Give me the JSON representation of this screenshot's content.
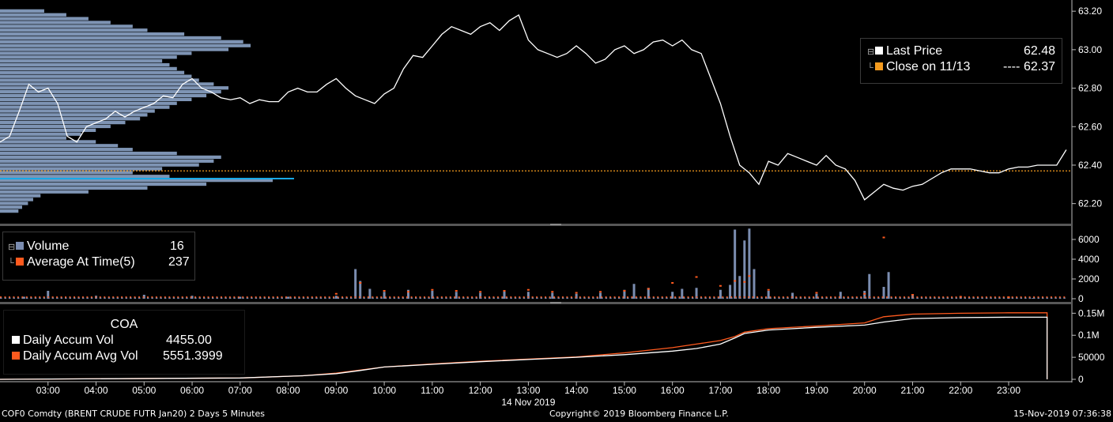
{
  "colors": {
    "price": "#ffffff",
    "profile": "#7e94b4",
    "profile_hi": "#19a8e6",
    "close_line": "#f39a1e",
    "avg": "#ff5a1e",
    "volume": "#7b8db0",
    "accum": "#ffffff",
    "accum_avg": "#ff5a1e",
    "panel_divider": "#575757"
  },
  "footer": {
    "left": "COF0 Comdty (BRENT CRUDE FUTR  Jan20) 2 Days 5 Minutes",
    "center": "Copyright© 2019 Bloomberg Finance L.P.",
    "right": "15-Nov-2019 07:36:38"
  },
  "price_legend": {
    "last_label": "Last Price",
    "last_value": "62.48",
    "close_label": "Close on 11/13",
    "close_dashes": "----",
    "close_value": "62.37"
  },
  "volume_legend": {
    "volume_label": "Volume",
    "volume_value": "16",
    "avg_label": "Average At Time(5)",
    "avg_value": "237"
  },
  "coa_legend": {
    "title": "COA",
    "accum_label": "Daily Accum Vol",
    "accum_value": "4455.00",
    "avg_label": "Daily Accum Avg Vol",
    "avg_value": "5551.3999"
  },
  "chart_data": [
    {
      "type": "line",
      "panel": "price",
      "ylim": [
        62.1,
        63.25
      ],
      "yticks": [
        "62.20",
        "62.40",
        "62.60",
        "62.80",
        "63.00",
        "63.20"
      ],
      "close_reference": 62.37,
      "series": [
        {
          "name": "Last Price",
          "x": [
            2.0,
            2.2,
            2.4,
            2.6,
            2.8,
            3.0,
            3.2,
            3.4,
            3.6,
            3.8,
            4.0,
            4.2,
            4.4,
            4.6,
            4.8,
            5.0,
            5.2,
            5.4,
            5.6,
            5.8,
            6.0,
            6.2,
            6.4,
            6.6,
            6.8,
            7.0,
            7.2,
            7.4,
            7.6,
            7.8,
            8.0,
            8.2,
            8.4,
            8.6,
            8.8,
            9.0,
            9.2,
            9.4,
            9.6,
            9.8,
            10.0,
            10.2,
            10.4,
            10.6,
            10.8,
            11.0,
            11.2,
            11.4,
            11.6,
            11.8,
            12.0,
            12.2,
            12.4,
            12.6,
            12.8,
            13.0,
            13.2,
            13.4,
            13.6,
            13.8,
            14.0,
            14.2,
            14.4,
            14.6,
            14.8,
            15.0,
            15.2,
            15.4,
            15.6,
            15.8,
            16.0,
            16.2,
            16.4,
            16.6,
            16.8,
            17.0,
            17.2,
            17.4,
            17.6,
            17.8,
            18.0,
            18.2,
            18.4,
            18.6,
            18.8,
            19.0,
            19.2,
            19.4,
            19.6,
            19.8,
            20.0,
            20.2,
            20.4,
            20.6,
            20.8,
            21.0,
            21.2,
            21.4,
            21.6,
            21.8,
            22.0,
            22.2,
            22.4,
            22.6,
            22.8,
            23.0,
            23.2,
            23.4,
            23.6,
            23.8,
            24.0,
            24.2
          ],
          "values": [
            62.52,
            62.55,
            62.68,
            62.82,
            62.78,
            62.8,
            62.72,
            62.55,
            62.52,
            62.6,
            62.62,
            62.64,
            62.68,
            62.65,
            62.68,
            62.7,
            62.72,
            62.76,
            62.75,
            62.82,
            62.85,
            62.8,
            62.78,
            62.75,
            62.74,
            62.75,
            62.72,
            62.74,
            62.73,
            62.73,
            62.78,
            62.8,
            62.78,
            62.78,
            62.82,
            62.85,
            62.8,
            62.76,
            62.74,
            62.72,
            62.77,
            62.8,
            62.9,
            62.97,
            62.96,
            63.02,
            63.08,
            63.12,
            63.1,
            63.08,
            63.12,
            63.14,
            63.1,
            63.15,
            63.18,
            63.05,
            63.0,
            62.98,
            62.96,
            62.98,
            63.02,
            62.98,
            62.93,
            62.95,
            63.0,
            63.02,
            62.98,
            63.0,
            63.04,
            63.05,
            63.02,
            63.05,
            63.0,
            62.98,
            62.85,
            62.72,
            62.55,
            62.4,
            62.36,
            62.3,
            62.42,
            62.4,
            62.46,
            62.44,
            62.42,
            62.4,
            62.45,
            62.4,
            62.38,
            62.32,
            62.22,
            62.26,
            62.3,
            62.28,
            62.27,
            62.29,
            62.3,
            62.33,
            62.36,
            62.38,
            62.38,
            62.38,
            62.37,
            62.36,
            62.36,
            62.38,
            62.39,
            62.39,
            62.4,
            62.4,
            62.4,
            62.48
          ]
        }
      ]
    },
    {
      "type": "bar",
      "panel": "volume",
      "ylim": [
        0,
        7200
      ],
      "yticks": [
        "0",
        "2000",
        "4000",
        "6000"
      ],
      "series": [
        {
          "name": "Volume",
          "x": [
            2.5,
            3.0,
            4.0,
            5.0,
            6.0,
            7.0,
            8.0,
            9.0,
            9.4,
            9.5,
            9.7,
            10.0,
            10.5,
            11.0,
            11.5,
            12.0,
            12.5,
            13.0,
            13.5,
            14.0,
            14.5,
            15.0,
            15.2,
            15.5,
            16.0,
            16.2,
            16.5,
            17.0,
            17.2,
            17.3,
            17.4,
            17.5,
            17.6,
            17.7,
            18.0,
            18.5,
            19.0,
            19.5,
            20.0,
            20.1,
            20.4,
            20.5,
            21.0,
            22.0,
            23.0,
            23.5
          ],
          "values": [
            200,
            800,
            300,
            400,
            300,
            200,
            200,
            300,
            3000,
            1800,
            1000,
            700,
            900,
            800,
            700,
            600,
            800,
            700,
            600,
            500,
            600,
            900,
            1500,
            1100,
            700,
            1000,
            1100,
            900,
            1400,
            7000,
            2300,
            5900,
            7100,
            3000,
            800,
            600,
            500,
            700,
            800,
            2500,
            1200,
            2700,
            400,
            200,
            100,
            60
          ]
        },
        {
          "name": "Average At Time(5)",
          "x": [
            9.0,
            9.5,
            10.0,
            10.5,
            11.0,
            11.5,
            12.0,
            12.5,
            13.0,
            13.5,
            14.0,
            14.5,
            15.0,
            15.5,
            16.0,
            16.5,
            17.0,
            17.3,
            17.5,
            17.6,
            18.0,
            19.0,
            20.0,
            20.4,
            21.0,
            22.0,
            23.0
          ],
          "values": [
            500,
            1600,
            800,
            700,
            900,
            800,
            700,
            800,
            900,
            700,
            600,
            700,
            800,
            1000,
            1600,
            2200,
            1300,
            1800,
            1700,
            2300,
            900,
            600,
            500,
            6200,
            400,
            200,
            150
          ]
        }
      ]
    },
    {
      "type": "line",
      "panel": "coa",
      "ylim": [
        0,
        165000
      ],
      "yticks": [
        "0",
        "50000",
        "0.1M",
        "0.15M"
      ],
      "series": [
        {
          "name": "Daily Accum Vol",
          "x": [
            2.0,
            7.0,
            8.3,
            9.0,
            9.5,
            10.0,
            11.0,
            12.0,
            13.0,
            14.0,
            15.0,
            16.0,
            16.5,
            17.0,
            17.3,
            17.5,
            18.0,
            19.0,
            20.0,
            20.4,
            21.0,
            22.0,
            23.0,
            23.8,
            23.8
          ],
          "values": [
            0,
            3000,
            8000,
            13000,
            20000,
            28000,
            34000,
            40000,
            45000,
            50000,
            56000,
            64000,
            70000,
            80000,
            94000,
            104000,
            112000,
            118000,
            123000,
            130000,
            138000,
            140000,
            141000,
            141000,
            0
          ]
        },
        {
          "name": "Daily Accum Avg Vol",
          "x": [
            2.0,
            7.0,
            8.3,
            9.0,
            9.5,
            10.0,
            11.0,
            12.0,
            13.0,
            14.0,
            15.0,
            16.0,
            16.5,
            17.0,
            17.3,
            17.5,
            18.0,
            19.0,
            20.0,
            20.4,
            21.0,
            22.0,
            23.0,
            23.8,
            23.8
          ],
          "values": [
            0,
            3000,
            8000,
            14000,
            21000,
            28000,
            35000,
            41000,
            46000,
            51000,
            60000,
            72000,
            80000,
            88000,
            97000,
            107000,
            115000,
            121000,
            128000,
            142000,
            148000,
            150000,
            151000,
            151000,
            0
          ]
        }
      ]
    }
  ],
  "x_axis": {
    "ticks": [
      "03:00",
      "04:00",
      "05:00",
      "06:00",
      "07:00",
      "08:00",
      "09:00",
      "10:00",
      "11:00",
      "12:00",
      "13:00",
      "14:00",
      "15:00",
      "16:00",
      "17:00",
      "18:00",
      "19:00",
      "20:00",
      "21:00",
      "22:00",
      "23:00"
    ],
    "date_label": "14 Nov 2019"
  },
  "volume_profile": {
    "prices": [
      62.16,
      62.18,
      62.2,
      62.22,
      62.24,
      62.26,
      62.28,
      62.3,
      62.32,
      62.34,
      62.36,
      62.38,
      62.4,
      62.42,
      62.44,
      62.46,
      62.48,
      62.5,
      62.52,
      62.54,
      62.56,
      62.58,
      62.6,
      62.62,
      62.64,
      62.66,
      62.68,
      62.7,
      62.72,
      62.74,
      62.76,
      62.78,
      62.8,
      62.82,
      62.84,
      62.86,
      62.88,
      62.9,
      62.92,
      62.94,
      62.96,
      62.98,
      63.0,
      63.02,
      63.04,
      63.06,
      63.08,
      63.1,
      63.12,
      63.14,
      63.16,
      63.18,
      63.2
    ],
    "volumes": [
      25,
      30,
      38,
      45,
      55,
      120,
      200,
      280,
      370,
      230,
      180,
      220,
      270,
      290,
      300,
      240,
      180,
      160,
      130,
      90,
      110,
      130,
      150,
      170,
      190,
      200,
      210,
      230,
      240,
      260,
      280,
      300,
      310,
      290,
      270,
      260,
      250,
      240,
      230,
      220,
      240,
      260,
      310,
      340,
      330,
      300,
      250,
      200,
      180,
      150,
      120,
      90,
      60
    ],
    "poc": 62.33
  }
}
